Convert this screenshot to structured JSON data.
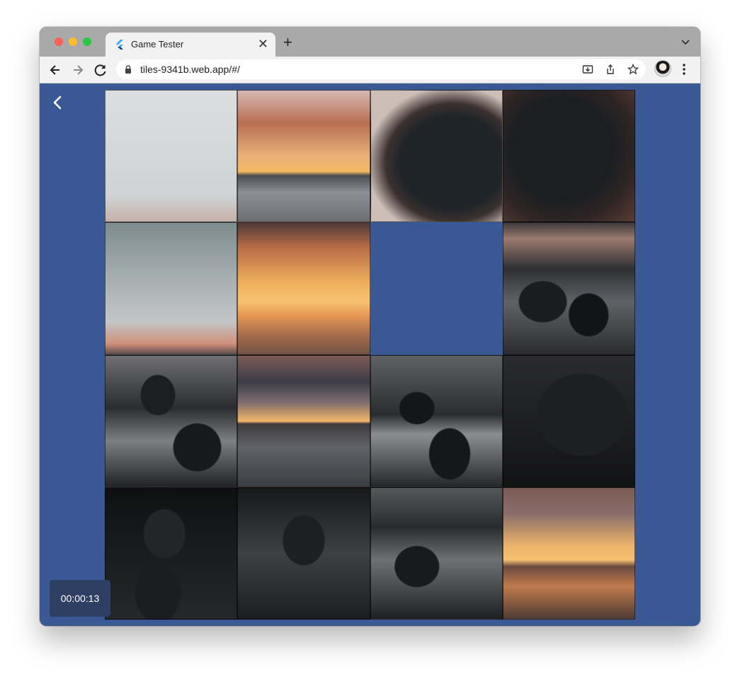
{
  "browser": {
    "tab_title": "Game Tester",
    "url": "tiles-9341b.web.app/#/",
    "tab_close_glyph": "✕",
    "new_tab_glyph": "+"
  },
  "icons": {
    "favicon": "flutter-logo-icon",
    "lock": "lock-icon",
    "back": "back-arrow-icon",
    "forward": "forward-arrow-icon",
    "reload": "reload-icon",
    "install": "install-app-icon",
    "share": "share-icon",
    "bookmark": "star-icon",
    "menu": "kebab-menu-icon",
    "tab_list": "chevron-down-icon",
    "game_back": "chevron-left-icon"
  },
  "colors": {
    "background": "#3a5894",
    "timer_bg": "#2f3f63"
  },
  "game": {
    "timer": "00:00:13",
    "grid_size": 4,
    "empty_slot": [
      1,
      2
    ]
  }
}
